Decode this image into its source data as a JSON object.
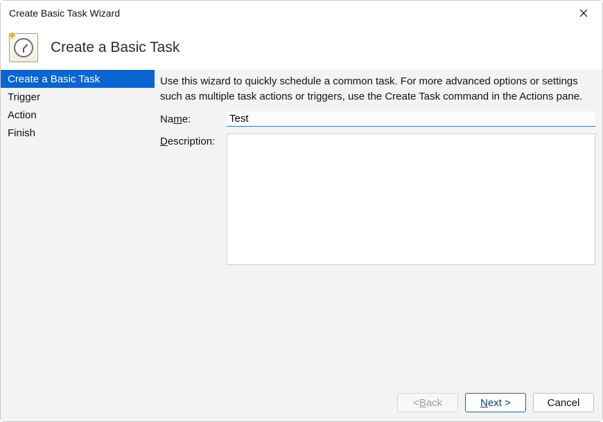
{
  "window": {
    "title": "Create Basic Task Wizard"
  },
  "header": {
    "title": "Create a Basic Task"
  },
  "sidebar": {
    "steps": [
      {
        "label": "Create a Basic Task",
        "selected": true
      },
      {
        "label": "Trigger",
        "selected": false
      },
      {
        "label": "Action",
        "selected": false
      },
      {
        "label": "Finish",
        "selected": false
      }
    ]
  },
  "main": {
    "intro": "Use this wizard to quickly schedule a common task.  For more advanced options or settings such as multiple task actions or triggers, use the Create Task command in the Actions pane.",
    "name_label_prefix": "Na",
    "name_label_ul": "m",
    "name_label_suffix": "e:",
    "name_value": "Test",
    "desc_label_ul": "D",
    "desc_label_suffix": "escription:",
    "desc_value": ""
  },
  "footer": {
    "back_prefix": "< ",
    "back_ul": "B",
    "back_suffix": "ack",
    "next_ul": "N",
    "next_suffix": "ext >",
    "cancel": "Cancel"
  }
}
